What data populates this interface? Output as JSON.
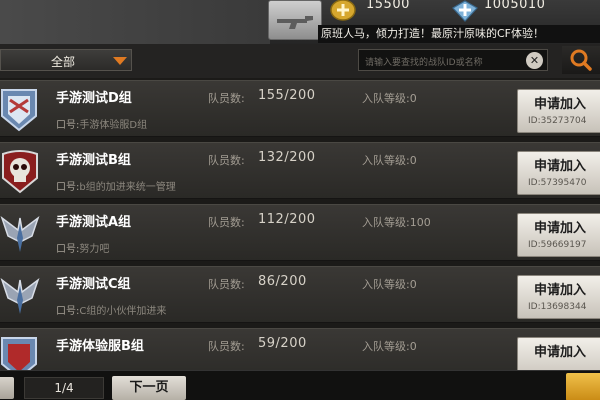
{
  "currency": {
    "gp_value": "15500",
    "cp_value": "1005010"
  },
  "ticker_text": "原班人马，倾力打造！最原汁原味的CF体验！",
  "filter": {
    "dropdown_label": "全部",
    "search_placeholder": "请输入要查找的战队ID或名称",
    "clear_symbol": "✕"
  },
  "list_labels": {
    "members": "队员数:",
    "level": "入队等级:",
    "motto_prefix": "口号:",
    "apply": "申请加入"
  },
  "teams": [
    {
      "name": "手游测试D组",
      "members": "155/200",
      "level": "0",
      "motto": "手游体验服D组",
      "id": "ID:35273704",
      "emblem": "shield-flag-emblem"
    },
    {
      "name": "手游测试B组",
      "members": "132/200",
      "level": "0",
      "motto": "b组的加进来统一管理",
      "id": "ID:57395470",
      "emblem": "skull-emblem"
    },
    {
      "name": "手游测试A组",
      "members": "112/200",
      "level": "100",
      "motto": "努力吧",
      "id": "ID:59669197",
      "emblem": "wings-blade-emblem"
    },
    {
      "name": "手游测试C组",
      "members": "86/200",
      "level": "0",
      "motto": "C组的小伙伴加进来",
      "id": "ID:13698344",
      "emblem": "wings-blade-emblem"
    },
    {
      "name": "手游体验服B组",
      "members": "59/200",
      "level": "0",
      "motto": "",
      "id": "",
      "emblem": "shield-flag-emblem"
    }
  ],
  "pagination": {
    "page": "1/4",
    "next_label": "下一页"
  },
  "colors": {
    "accent_orange": "#e07a22",
    "gold": "#f0c14a"
  }
}
